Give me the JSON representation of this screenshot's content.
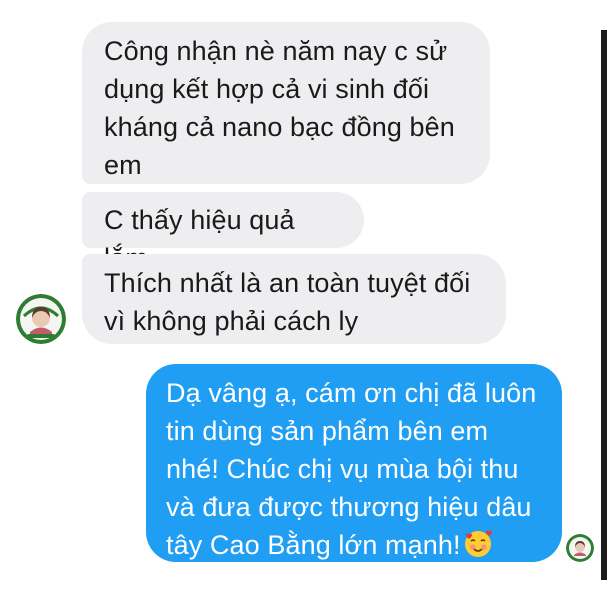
{
  "messages": {
    "incoming": [
      {
        "text": "Công nhận nè năm nay c sử\ndụng kết hợp cả vi sinh đối\nkháng cả nano bạc đồng bên\nem"
      },
      {
        "text": "C thấy hiệu quả lắm"
      },
      {
        "text": "Thích nhất là an toàn tuyệt đối\nvì không phải cách ly"
      }
    ],
    "outgoing": [
      {
        "text": "Dạ vâng ạ, cám ơn chị đã luôn\ntin dùng sản phẩm bên em\nnhé! Chúc chị vụ mùa bội thu\nvà đưa được thương hiệu dâu\ntây Cao Bằng lớn mạnh!",
        "emoji": "smiling-face-with-hearts"
      }
    ]
  },
  "colors": {
    "incoming_bubble": "#eeeef0",
    "outgoing_bubble": "#1f9ef3",
    "incoming_text": "#1a1a1a",
    "outgoing_text": "#ffffff"
  }
}
